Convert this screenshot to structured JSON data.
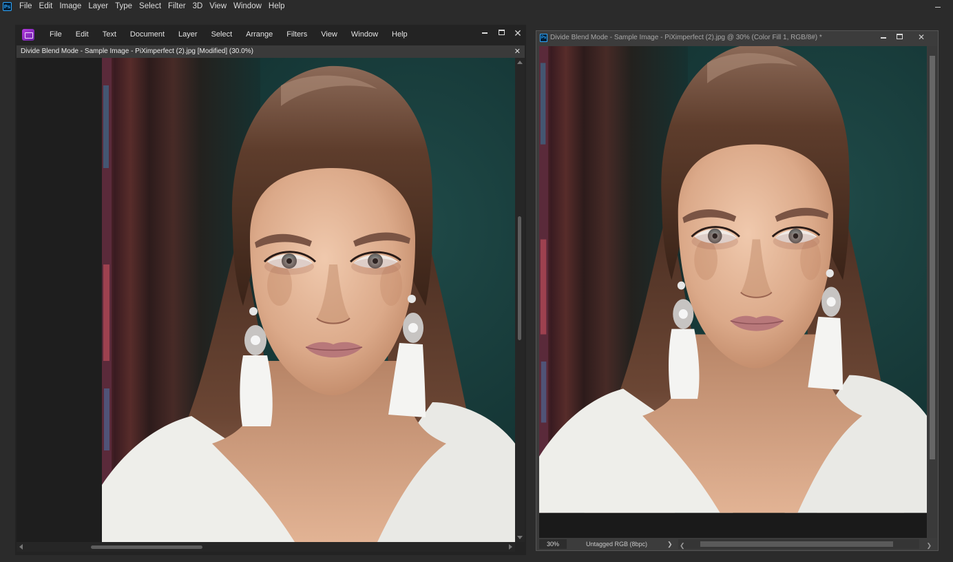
{
  "photoshop": {
    "app_icon": "Ps",
    "menu": [
      "File",
      "Edit",
      "Image",
      "Layer",
      "Type",
      "Select",
      "Filter",
      "3D",
      "View",
      "Window",
      "Help"
    ],
    "doc_title": "Divide Blend Mode - Sample Image - PiXimperfect (2).jpg @ 30% (Color Fill 1, RGB/8#) *",
    "status": {
      "zoom": "30%",
      "doc_info": "Untagged RGB (8bpc)",
      "arrow": "❯",
      "scroll_left": "❮",
      "scroll_right": "❯"
    }
  },
  "affinity": {
    "menu": [
      "File",
      "Edit",
      "Text",
      "Document",
      "Layer",
      "Select",
      "Arrange",
      "Filters",
      "View",
      "Window",
      "Help"
    ],
    "doc_tab": "Divide Blend Mode - Sample Image - PiXimperfect (2).jpg [Modified] (30.0%)",
    "close_glyph": "✕",
    "min_glyph": "▁",
    "max_glyph": "▣"
  },
  "colors": {
    "app_background": "#2b2b2b",
    "photoshop_blue": "#31a8ff",
    "affinity_purple": "#b43adf",
    "photo_background_teal": "#1d4442",
    "photo_hair_brown": "#5a3828",
    "photo_blouse_white": "#eeeeea"
  },
  "icons": {
    "photoshop_app": "photoshop-logo-icon",
    "affinity_app": "affinity-photo-logo-icon",
    "close": "close-icon",
    "minimize": "minimize-icon",
    "maximize": "maximize-icon"
  }
}
